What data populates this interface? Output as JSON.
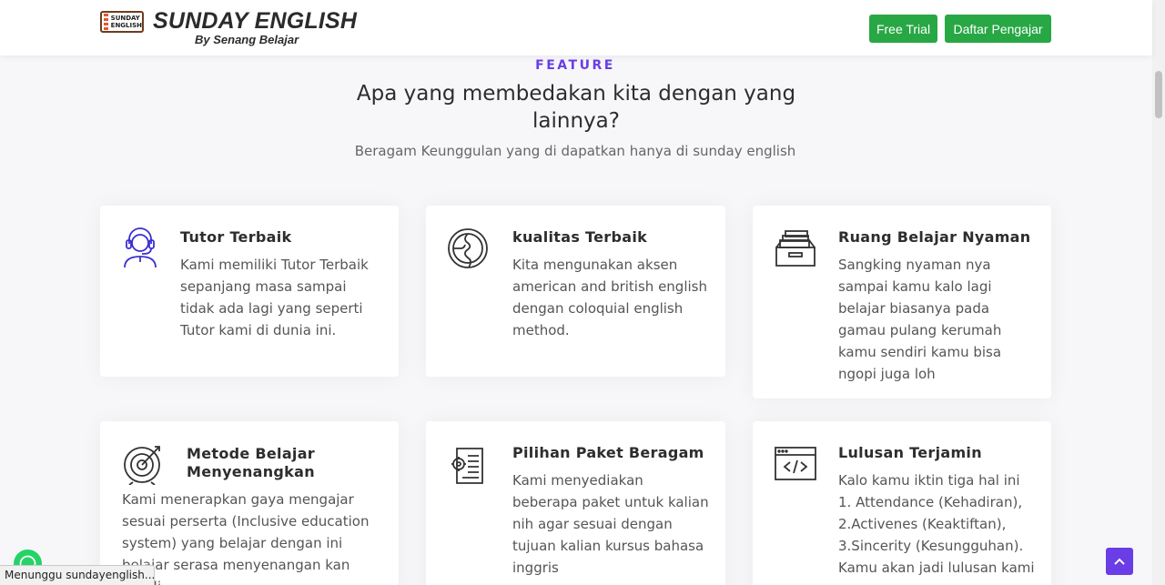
{
  "header": {
    "logo_badge": "SUNDAY ENGLISH",
    "logo_title": "SUNDAY ENGLISH",
    "logo_subtitle": "By Senang Belajar",
    "buttons": [
      {
        "label": "Free Trial"
      },
      {
        "label": "Daftar Pengajar"
      }
    ]
  },
  "section": {
    "label": "FEATURE",
    "title": "Apa yang membedakan kita dengan yang lainnya?",
    "subtitle": "Beragam Keunggulan yang di dapatkan hanya di sunday english"
  },
  "features": [
    {
      "icon": "support-agent-icon",
      "title": "Tutor Terbaik",
      "description": "Kami memiliki Tutor Terbaik sepanjang masa sampai tidak ada lagi yang seperti Tutor kami di dunia ini."
    },
    {
      "icon": "globe-icon",
      "title": "kualitas Terbaik",
      "description": "Kita mengunakan aksen american and british english dengan coloquial english method."
    },
    {
      "icon": "file-drawer-icon",
      "title": "Ruang Belajar Nyaman",
      "description": "Sangking nyaman nya sampai kamu kalo lagi belajar biasanya pada gamau pulang kerumah kamu sendiri kamu bisa ngopi juga loh"
    },
    {
      "icon": "target-icon",
      "title": "Metode Belajar Menyenangkan",
      "description": "Kami menerapkan gaya mengajar sesuai perserta (Inclusive education system) yang belajar dengan ini belajar serasa menyenangan kan sekali"
    },
    {
      "icon": "document-settings-icon",
      "title": "Pilihan Paket Beragam",
      "description": "Kami menyediakan beberapa paket untuk kalian nih agar sesuai dengan tujuan kalian kursus bahasa inggris"
    },
    {
      "icon": "code-window-icon",
      "title": "Lulusan Terjamin",
      "description": "Kalo kamu iktin tiga hal ini 1. Attendance (Kehadiran), 2.Activenes (Keaktiftan), 3.Sincerity (Kesungguhan). Kamu akan jadi lulusan kami"
    }
  ],
  "status_text": "Menunggu sundayenglish....",
  "colors": {
    "accent": "#6b3de6",
    "button_green": "#28a745",
    "icon_primary": "#3a2fd1",
    "icon_dark": "#333333"
  }
}
